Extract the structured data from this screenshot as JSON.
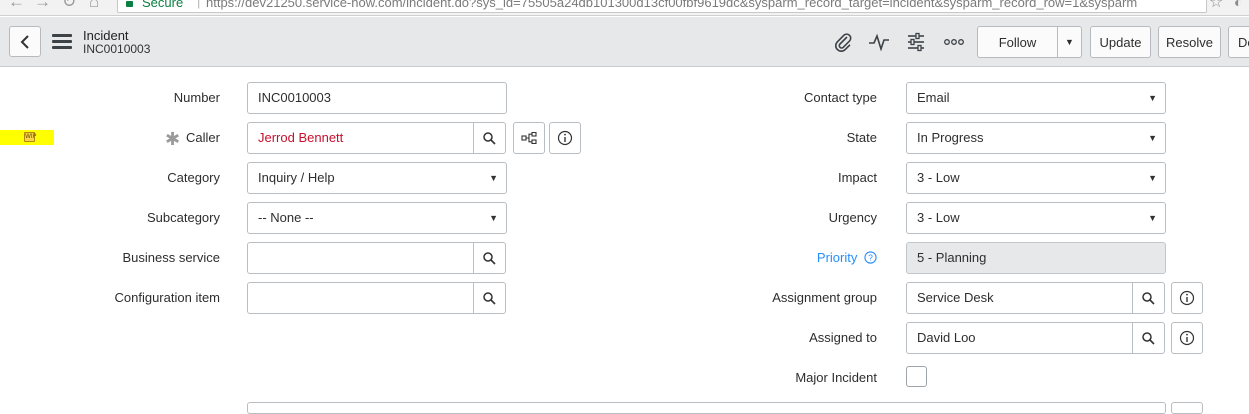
{
  "browser": {
    "secure_label": "Secure",
    "url": "https://dev21250.service-now.com/incident.do?sys_id=75505a24db101300d13cf00fbf9619dc&sysparm_record_target=incident&sysparm_record_row=1&sysparm"
  },
  "header": {
    "title": "Incident",
    "number": "INC0010003",
    "buttons": {
      "follow": "Follow",
      "update": "Update",
      "resolve": "Resolve",
      "delete_partial": "De"
    }
  },
  "annotation": {
    "wip_label": "WIP",
    "highlight_color": "#ffff00"
  },
  "colors": {
    "link": "#278efc",
    "caller_text": "#c8102e",
    "readonly_bg": "#e6e8ea",
    "header_bg": "#e6e8ea"
  },
  "form": {
    "left": {
      "number": {
        "label": "Number",
        "value": "INC0010003"
      },
      "caller": {
        "label": "Caller",
        "value": "Jerrod Bennett"
      },
      "category": {
        "label": "Category",
        "value": "Inquiry / Help"
      },
      "subcategory": {
        "label": "Subcategory",
        "value": "-- None --"
      },
      "business_service": {
        "label": "Business service",
        "value": ""
      },
      "configuration_item": {
        "label": "Configuration item",
        "value": ""
      }
    },
    "right": {
      "contact_type": {
        "label": "Contact type",
        "value": "Email"
      },
      "state": {
        "label": "State",
        "value": "In Progress"
      },
      "impact": {
        "label": "Impact",
        "value": "3 - Low"
      },
      "urgency": {
        "label": "Urgency",
        "value": "3 - Low"
      },
      "priority": {
        "label": "Priority",
        "value": "5 - Planning"
      },
      "assignment_group": {
        "label": "Assignment group",
        "value": "Service Desk"
      },
      "assigned_to": {
        "label": "Assigned to",
        "value": "David Loo"
      },
      "major_incident": {
        "label": "Major Incident",
        "checked": false
      }
    }
  }
}
